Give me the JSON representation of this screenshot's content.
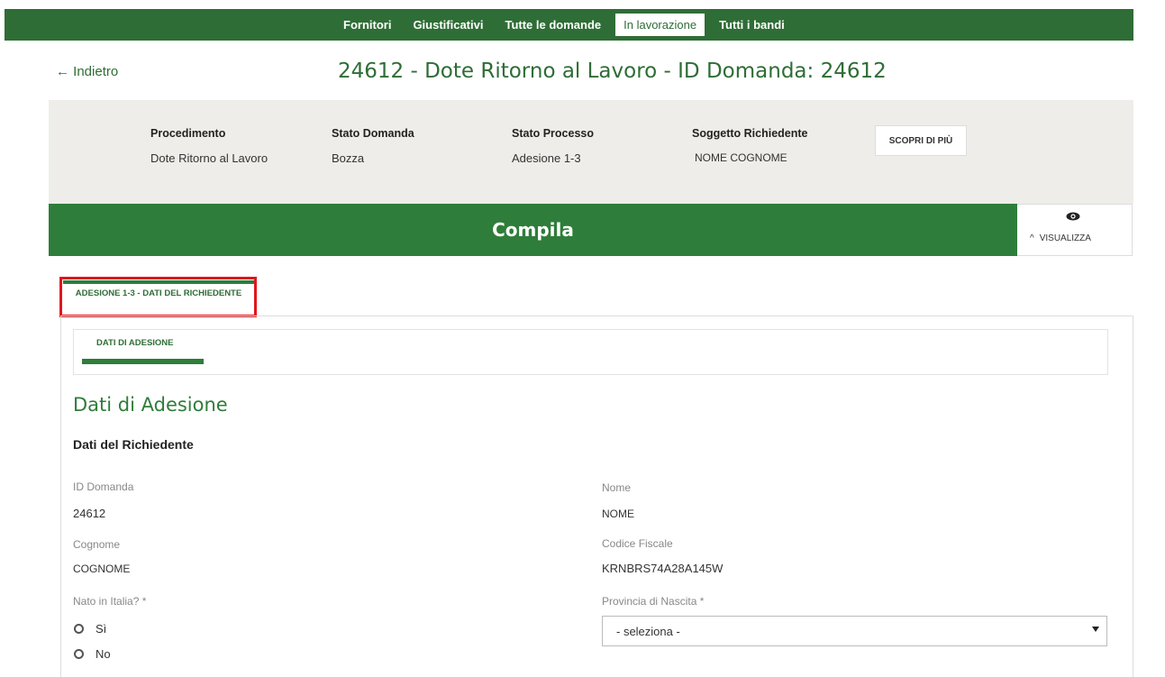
{
  "nav": {
    "items": [
      {
        "label": "Fornitori"
      },
      {
        "label": "Giustificativi"
      },
      {
        "label": "Tutte le domande"
      },
      {
        "label": "In lavorazione",
        "active": true
      },
      {
        "label": "Tutti i bandi"
      }
    ]
  },
  "header": {
    "back_label": "← Indietro",
    "title": "24612 - Dote Ritorno al Lavoro - ID Domanda: 24612"
  },
  "info": {
    "procedimento_label": "Procedimento",
    "procedimento_value": "Dote Ritorno al Lavoro",
    "stato_domanda_label": "Stato Domanda",
    "stato_domanda_value": "Bozza",
    "stato_processo_label": "Stato Processo",
    "stato_processo_value": "Adesione 1-3",
    "soggetto_label": "Soggetto Richiedente",
    "soggetto_value": "NOME COGNOME",
    "scopri_label": "SCOPRI DI PIÙ"
  },
  "compila": {
    "title": "Compila",
    "visualizza_label": "VISUALIZZA"
  },
  "tabs": {
    "main_tab": "ADESIONE 1-3 - DATI DEL RICHIEDENTE",
    "sub_tab": "DATI DI ADESIONE"
  },
  "section": {
    "title": "Dati di Adesione",
    "subtitle": "Dati del Richiedente"
  },
  "fields": {
    "id_domanda_label": "ID Domanda",
    "id_domanda_value": "24612",
    "nome_label": "Nome",
    "nome_value": "NOME",
    "cognome_label": "Cognome",
    "cognome_value": "COGNOME",
    "codice_fiscale_label": "Codice Fiscale",
    "codice_fiscale_value": "KRNBRS74A28A145W",
    "nato_italia_label": "Nato in Italia? *",
    "radio_si": "Sì",
    "radio_no": "No",
    "provincia_label": "Provincia di Nascita *",
    "provincia_value": "- seleziona -"
  },
  "colors": {
    "brand_green": "#2f6d36",
    "accent_green": "#2f7d3a",
    "highlight_red": "#e0161e"
  }
}
